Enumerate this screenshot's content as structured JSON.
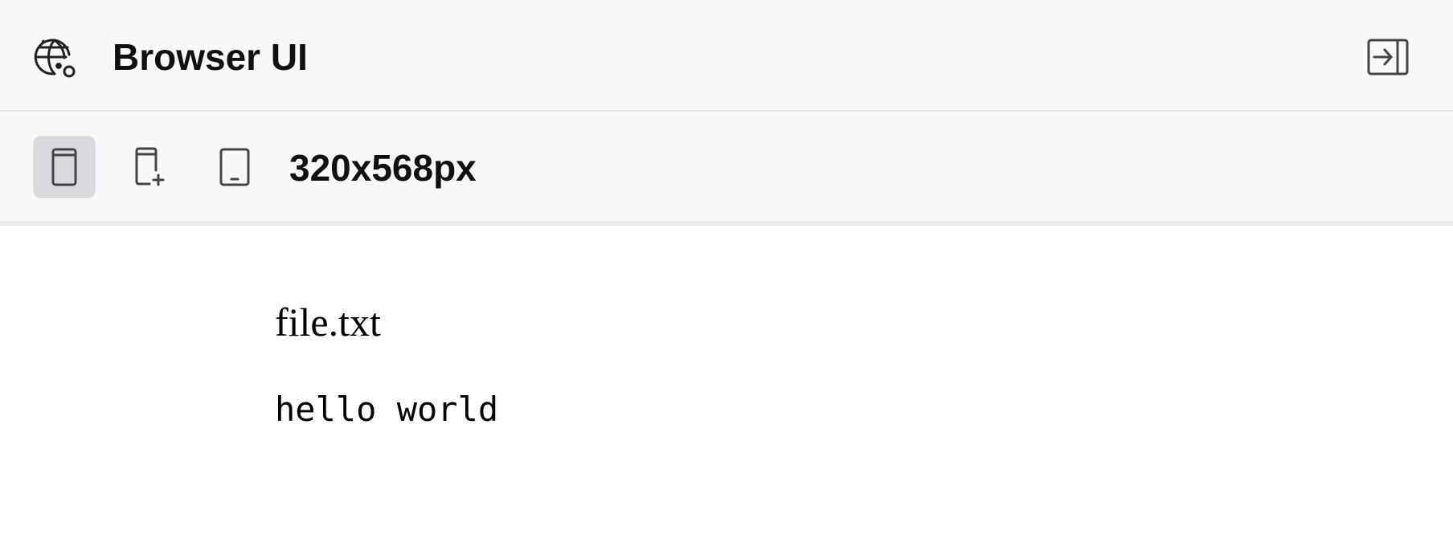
{
  "header": {
    "title": "Browser UI",
    "icon": "globe-icon",
    "collapse_icon": "panel-collapse-right-icon"
  },
  "toolbar": {
    "buttons": [
      {
        "icon": "device-phone-icon",
        "active": true
      },
      {
        "icon": "device-phone-add-icon",
        "active": false
      },
      {
        "icon": "device-tablet-icon",
        "active": false
      }
    ],
    "size_label": "320x568px"
  },
  "content": {
    "file_name": "file.txt",
    "file_body": "hello world"
  },
  "colors": {
    "chrome_bg": "#f7f8fa",
    "active_button_bg": "#d8dade",
    "icon_stroke": "#444444",
    "divider": "#e6e7ea"
  }
}
